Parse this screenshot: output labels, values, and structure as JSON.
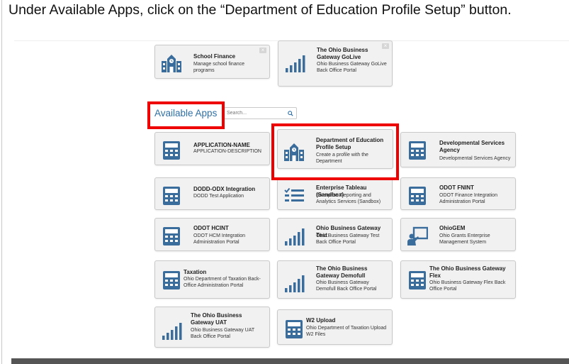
{
  "instruction": "Under Available Apps, click on the “Department of Education Profile Setup” button.",
  "favorites": [
    {
      "title": "School Finance",
      "description": "Manage school finance programs",
      "icon": "building-icon",
      "close": "×"
    },
    {
      "title": "The Ohio Business Gateway GoLive",
      "description": "Ohio Business Gateway GoLive Back Office Portal",
      "icon": "bar-chart-icon",
      "close": "×"
    }
  ],
  "available_apps": {
    "title": "Available Apps",
    "search_placeholder": "Search..."
  },
  "apps": [
    {
      "title": "APPLICATION-NAME",
      "description": "APPLICATION-DESCRIPTION",
      "icon": "calculator-icon"
    },
    {
      "title": "Department of Education Profile Setup",
      "description": "Create a profile with the Department",
      "icon": "building-icon"
    },
    {
      "title": "Developmental Services Agency",
      "description": "Developmental Services Agency",
      "icon": "calculator-icon"
    },
    {
      "title": "DODD-ODX Integration",
      "description": "DODD Test Application",
      "icon": "calculator-icon"
    },
    {
      "title": "Enterprise Tableau (Sandbox)",
      "description": "Enterprise Reporting and Analytics Services (Sandbox)",
      "icon": "checklist-icon"
    },
    {
      "title": "ODOT FNINT",
      "description": "ODOT Finance Integration Administration Portal",
      "icon": "calculator-icon"
    },
    {
      "title": "ODOT HCINT",
      "description": "ODOT HCM Integration Administration Portal",
      "icon": "calculator-icon"
    },
    {
      "title": "Ohio Business Gateway Test",
      "description": "Ohio Business Gateway Test Back Office Portal",
      "icon": "bar-chart-icon"
    },
    {
      "title": "OhioGEM",
      "description": "Ohio Grants Enterprise Management System",
      "icon": "presenter-icon"
    },
    {
      "title": "Taxation",
      "description": "Ohio Department of Taxation Back-Office Administration Portal",
      "icon": "calculator-icon"
    },
    {
      "title": "The Ohio Business Gateway Demofull",
      "description": "Ohio Business Gateway Demofull Back Office Portal",
      "icon": "bar-chart-icon"
    },
    {
      "title": "The Ohio Business Gateway Flex",
      "description": "Ohio Business Gateway Flex Back Office Portal",
      "icon": "calculator-icon"
    },
    {
      "title": "The Ohio Business Gateway UAT",
      "description": "Ohio Business Gateway UAT Back Office Portal",
      "icon": "bar-chart-icon"
    },
    {
      "title": "W2 Upload",
      "description": "Ohio Department of Taxation Upload W2 Files",
      "icon": "calculator-icon"
    }
  ],
  "colors": {
    "icon_blue": "#3a6d9c",
    "title_blue": "#2e6fa5",
    "highlight_red": "#ee0000"
  }
}
